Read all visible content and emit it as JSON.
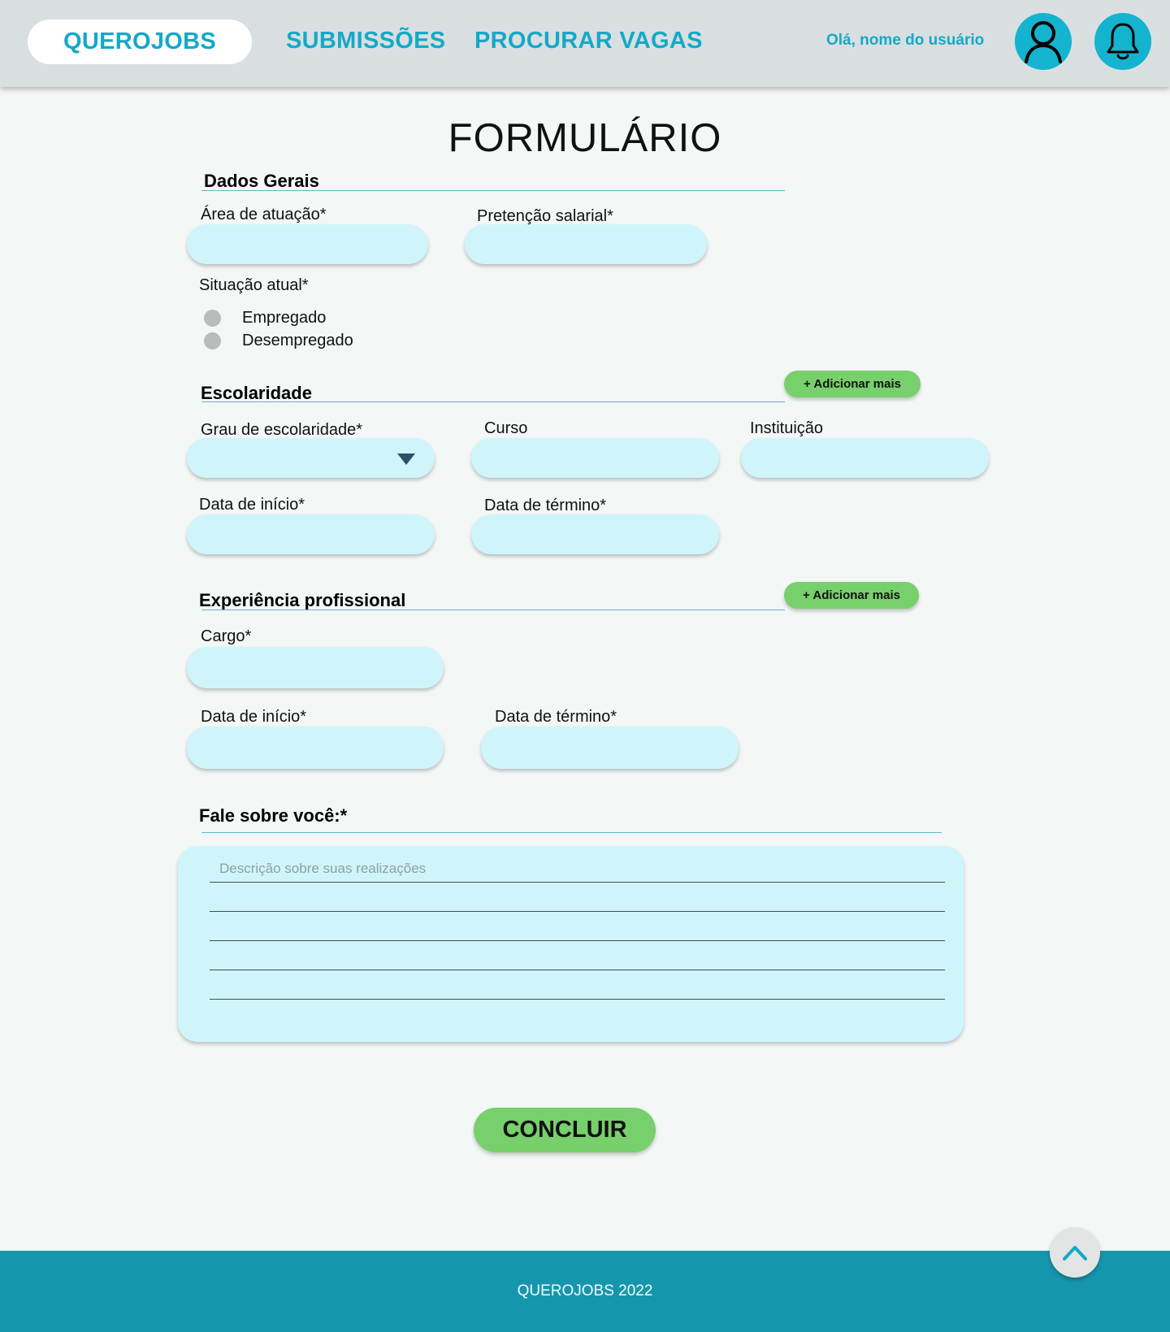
{
  "header": {
    "logo": "QUEROJOBS",
    "nav": [
      "SUBMISSÕES",
      "PROCURAR VAGAS"
    ],
    "greeting": "Olá, nome do usuário",
    "icons": [
      "user-icon",
      "bell-icon"
    ]
  },
  "page_title": "FORMULÁRIO",
  "dados_gerais": {
    "heading": "Dados Gerais",
    "area_label": "Área de atuação*",
    "salario_label": "Pretenção salarial*",
    "situacao_label": "Situação atual*",
    "options": [
      "Empregado",
      "Desempregado"
    ]
  },
  "escolaridade": {
    "heading": "Escolaridade",
    "add_label": "+ Adicionar mais",
    "grau_label": "Grau de escolaridade*",
    "curso_label": "Curso",
    "instituicao_label": "Instituição",
    "inicio_label": "Data de início*",
    "termino_label": "Data de término*"
  },
  "experiencia": {
    "heading": "Experiência profissional",
    "add_label": "+ Adicionar mais",
    "cargo_label": "Cargo*",
    "inicio_label": "Data de início*",
    "termino_label": "Data de término*"
  },
  "sobre": {
    "heading": "Fale sobre você:*",
    "placeholder": "Descrição sobre suas realizações"
  },
  "submit_label": "CONCLUIR",
  "footer": {
    "text": "QUEROJOBS 2022"
  },
  "colors": {
    "accent": "#14a9c7",
    "field": "#cff5fb",
    "button": "#78d06c",
    "footer": "#1696ad"
  }
}
